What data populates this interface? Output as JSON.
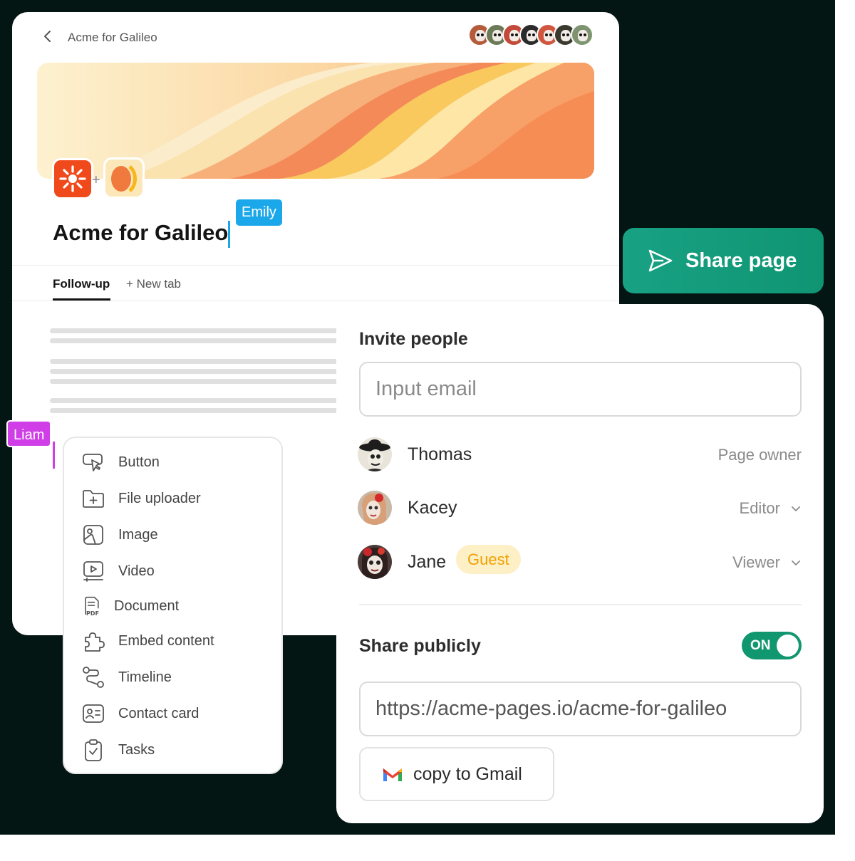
{
  "page": {
    "breadcrumb": "Acme for Galileo",
    "title": "Acme for Galileo",
    "tabs": [
      {
        "label": "Follow-up",
        "active": true
      },
      {
        "label": "+ New tab",
        "active": false
      }
    ]
  },
  "cursors": [
    {
      "name": "Emily",
      "color": "#1ba8ea"
    },
    {
      "name": "Liam",
      "color": "#cf3ee6"
    }
  ],
  "block_menu": {
    "items": [
      {
        "label": "Button",
        "icon": "cursor-click-icon"
      },
      {
        "label": "File uploader",
        "icon": "folder-plus-icon"
      },
      {
        "label": "Image",
        "icon": "image-icon"
      },
      {
        "label": "Video",
        "icon": "video-icon"
      },
      {
        "label": "Document",
        "icon": "pdf-document-icon"
      },
      {
        "label": "Embed content",
        "icon": "puzzle-icon"
      },
      {
        "label": "Timeline",
        "icon": "timeline-icon"
      },
      {
        "label": "Contact card",
        "icon": "contact-card-icon"
      },
      {
        "label": "Tasks",
        "icon": "clipboard-check-icon"
      }
    ]
  },
  "share_button": {
    "label": "Share page",
    "icon": "send-icon",
    "color": "#18a184"
  },
  "share_panel": {
    "invite_title": "Invite people",
    "email_placeholder": "Input email",
    "people": [
      {
        "name": "Thomas",
        "role": "Page owner",
        "dropdown": false
      },
      {
        "name": "Kacey",
        "role": "Editor",
        "dropdown": true
      },
      {
        "name": "Jane",
        "badge": "Guest",
        "role": "Viewer",
        "dropdown": true
      }
    ],
    "public_title": "Share publicly",
    "public_toggle": "ON",
    "url": "https://acme-pages.io/acme-for-galileo",
    "gmail_button": "copy to Gmail"
  }
}
